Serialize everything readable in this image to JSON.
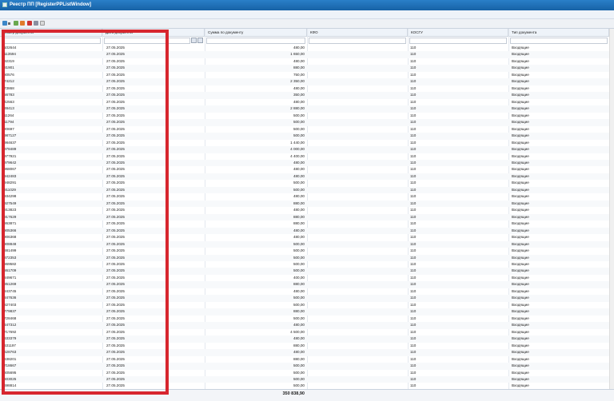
{
  "window": {
    "title": "Реестр ПП [RegisterPPListWindow]"
  },
  "toolbar": {
    "buttons": [
      "menu-button",
      "menu-arrow",
      "add-button",
      "edit-button",
      "delete-button",
      "refresh-button",
      "print-button"
    ]
  },
  "columns": [
    {
      "label": "Номер документа"
    },
    {
      "label": "Дата документа"
    },
    {
      "label": "Сумма по документу"
    },
    {
      "label": "КФО"
    },
    {
      "label": "КОСГУ"
    },
    {
      "label": "Тип документа"
    }
  ],
  "rows": [
    [
      "102644",
      "27.05.2025",
      "480,00",
      "",
      "110",
      "Входящие"
    ],
    [
      "113594",
      "27.05.2025",
      "1 650,00",
      "",
      "110",
      "Входящие"
    ],
    [
      "92319",
      "27.05.2025",
      "480,00",
      "",
      "110",
      "Входящие"
    ],
    [
      "81901",
      "27.05.2025",
      "880,00",
      "",
      "110",
      "Входящие"
    ],
    [
      "80576",
      "27.05.2025",
      "750,00",
      "",
      "110",
      "Входящие"
    ],
    [
      "74212",
      "27.05.2025",
      "2 350,00",
      "",
      "110",
      "Входящие"
    ],
    [
      "73868",
      "27.05.2025",
      "480,00",
      "",
      "110",
      "Входящие"
    ],
    [
      "56783",
      "27.05.2025",
      "350,00",
      "",
      "110",
      "Входящие"
    ],
    [
      "42563",
      "27.05.2025",
      "480,00",
      "",
      "110",
      "Входящие"
    ],
    [
      "28413",
      "27.05.2025",
      "2 880,00",
      "",
      "110",
      "Входящие"
    ],
    [
      "11264",
      "27.05.2025",
      "500,00",
      "",
      "110",
      "Входящие"
    ],
    [
      "11794",
      "27.05.2025",
      "500,00",
      "",
      "110",
      "Входящие"
    ],
    [
      "20697",
      "27.05.2025",
      "500,00",
      "",
      "110",
      "Входящие"
    ],
    [
      "987127",
      "27.05.2025",
      "500,00",
      "",
      "110",
      "Входящие"
    ],
    [
      "984637",
      "27.05.2025",
      "1 440,00",
      "",
      "110",
      "Входящие"
    ],
    [
      "978489",
      "27.05.2025",
      "4 000,00",
      "",
      "110",
      "Входящие"
    ],
    [
      "977921",
      "27.05.2025",
      "4 400,00",
      "",
      "110",
      "Входящие"
    ],
    [
      "979642",
      "27.05.2025",
      "480,00",
      "",
      "110",
      "Входящие"
    ],
    [
      "968067",
      "27.05.2025",
      "480,00",
      "",
      "110",
      "Входящие"
    ],
    [
      "942483",
      "27.05.2025",
      "480,00",
      "",
      "110",
      "Входящие"
    ],
    [
      "948291",
      "27.05.2025",
      "500,00",
      "",
      "110",
      "Входящие"
    ],
    [
      "911029",
      "27.05.2025",
      "500,00",
      "",
      "110",
      "Входящие"
    ],
    [
      "934298",
      "27.05.2025",
      "480,00",
      "",
      "110",
      "Входящие"
    ],
    [
      "927549",
      "27.05.2025",
      "880,00",
      "",
      "110",
      "Входящие"
    ],
    [
      "913823",
      "27.05.2025",
      "480,00",
      "",
      "110",
      "Входящие"
    ],
    [
      "917629",
      "27.05.2025",
      "880,00",
      "",
      "110",
      "Входящие"
    ],
    [
      "863871",
      "27.05.2025",
      "880,00",
      "",
      "110",
      "Входящие"
    ],
    [
      "905366",
      "27.05.2025",
      "480,00",
      "",
      "110",
      "Входящие"
    ],
    [
      "906368",
      "27.05.2025",
      "480,00",
      "",
      "110",
      "Входящие"
    ],
    [
      "908848",
      "27.05.2025",
      "500,00",
      "",
      "110",
      "Входящие"
    ],
    [
      "881499",
      "27.05.2025",
      "500,00",
      "",
      "110",
      "Входящие"
    ],
    [
      "872353",
      "27.05.2025",
      "500,00",
      "",
      "110",
      "Входящие"
    ],
    [
      "869582",
      "27.05.2025",
      "500,00",
      "",
      "110",
      "Входящие"
    ],
    [
      "861709",
      "27.05.2025",
      "500,00",
      "",
      "110",
      "Входящие"
    ],
    [
      "849671",
      "27.05.2025",
      "400,00",
      "",
      "110",
      "Входящие"
    ],
    [
      "851269",
      "27.05.2025",
      "880,00",
      "",
      "110",
      "Входящие"
    ],
    [
      "843745",
      "27.05.2025",
      "480,00",
      "",
      "110",
      "Входящие"
    ],
    [
      "847636",
      "27.05.2025",
      "500,00",
      "",
      "110",
      "Входящие"
    ],
    [
      "827403",
      "27.05.2025",
      "500,00",
      "",
      "110",
      "Входящие"
    ],
    [
      "779837",
      "27.05.2025",
      "880,00",
      "",
      "110",
      "Входящие"
    ],
    [
      "728468",
      "27.05.2025",
      "500,00",
      "",
      "110",
      "Входящие"
    ],
    [
      "647312",
      "27.05.2025",
      "480,00",
      "",
      "110",
      "Входящие"
    ],
    [
      "717692",
      "27.05.2025",
      "4 500,00",
      "",
      "110",
      "Входящие"
    ],
    [
      "633379",
      "27.05.2025",
      "480,00",
      "",
      "110",
      "Входящие"
    ],
    [
      "631197",
      "27.05.2025",
      "880,00",
      "",
      "110",
      "Входящие"
    ],
    [
      "628763",
      "27.05.2025",
      "480,00",
      "",
      "110",
      "Входящие"
    ],
    [
      "638201",
      "27.05.2025",
      "880,00",
      "",
      "110",
      "Входящие"
    ],
    [
      "718667",
      "27.05.2025",
      "500,00",
      "",
      "110",
      "Входящие"
    ],
    [
      "605695",
      "27.05.2025",
      "500,00",
      "",
      "110",
      "Входящие"
    ],
    [
      "603025",
      "27.05.2025",
      "500,00",
      "",
      "110",
      "Входящие"
    ],
    [
      "698814",
      "27.05.2025",
      "500,00",
      "",
      "110",
      "Входящие"
    ]
  ],
  "footer": {
    "total": "350 838,90"
  },
  "colors": {
    "titlebar": "#1762a6",
    "highlight": "#d7262e"
  }
}
